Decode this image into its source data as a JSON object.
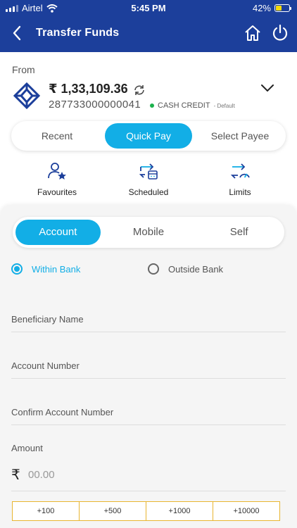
{
  "status_bar": {
    "carrier": "Airtel",
    "time": "5:45 PM",
    "battery": "42%"
  },
  "header": {
    "title": "Transfer Funds"
  },
  "from": {
    "label": "From",
    "balance": "₹ 1,33,109.36",
    "account_number": "287733000000041",
    "account_type": "CASH CREDIT",
    "default_tag": "- Default"
  },
  "top_tabs": [
    {
      "label": "Recent"
    },
    {
      "label": "Quick Pay"
    },
    {
      "label": "Select Payee"
    }
  ],
  "quick_links": [
    {
      "label": "Favourites",
      "icon": "favourites-icon"
    },
    {
      "label": "Scheduled",
      "icon": "scheduled-icon"
    },
    {
      "label": "Limits",
      "icon": "limits-icon"
    }
  ],
  "sub_tabs": [
    {
      "label": "Account"
    },
    {
      "label": "Mobile"
    },
    {
      "label": "Self"
    }
  ],
  "radios": {
    "within": "Within Bank",
    "outside": "Outside Bank"
  },
  "fields": {
    "beneficiary_name": "Beneficiary Name",
    "account_number": "Account Number",
    "confirm_account_number": "Confirm Account Number"
  },
  "amount": {
    "label": "Amount",
    "currency": "₹",
    "placeholder": "00.00"
  },
  "quick_amounts": [
    "+100",
    "+500",
    "+1000",
    "+10000"
  ],
  "colors": {
    "primary": "#1c3f9b",
    "accent": "#12aee6",
    "chip_border": "#e8b530",
    "status_dot": "#1bb14c"
  }
}
